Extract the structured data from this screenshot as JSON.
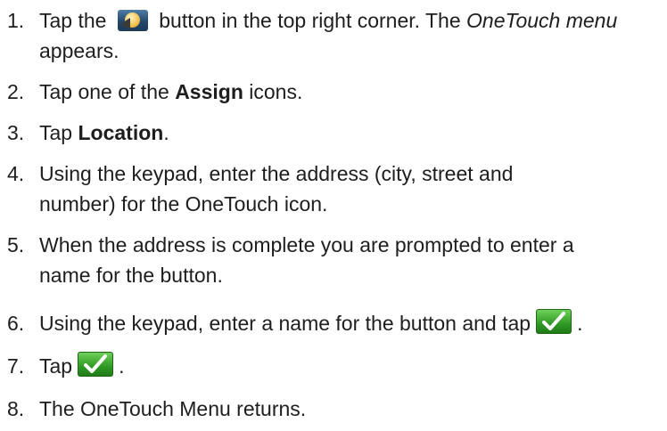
{
  "steps": [
    {
      "number": "1.",
      "before_icon": "Tap the",
      "icon": "onetouch-menu-icon",
      "after_icon": "button in the top right corner. The",
      "italic_term": "OneTouch menu",
      "end": "appears."
    },
    {
      "number": "2.",
      "before": "Tap one of the",
      "bold": "Assign",
      "after": "icons."
    },
    {
      "number": "3.",
      "before": "Tap",
      "bold": "Location",
      "after": "."
    },
    {
      "number": "4.",
      "text": "Using the keypad, enter the address (city, street and number) for the OneTouch icon."
    },
    {
      "number": "5.",
      "text": "When the address is complete you are prompted to enter a name for the button."
    },
    {
      "number": "6.",
      "text": "Using the keypad, enter a name for the button and tap",
      "icon": "green-check-icon",
      "end": "."
    },
    {
      "number": "7.",
      "text": "Tap",
      "icon": "green-check-icon",
      "end": "."
    },
    {
      "number": "8.",
      "text": "The OneTouch Menu returns."
    }
  ]
}
